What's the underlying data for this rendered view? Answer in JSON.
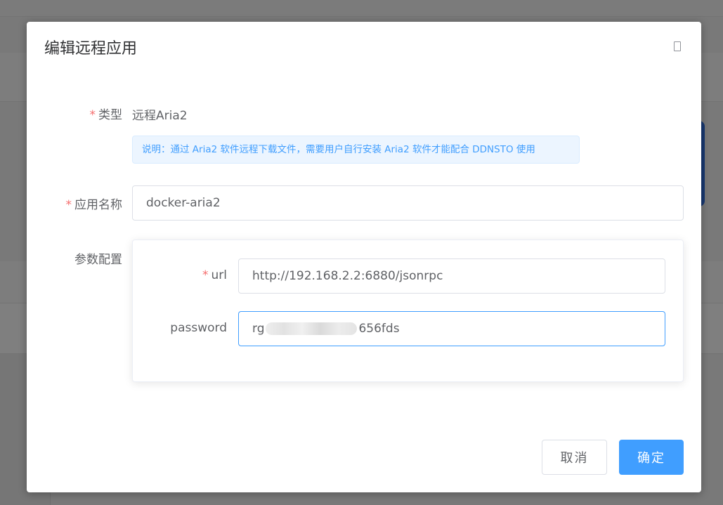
{
  "dialog": {
    "title": "编辑远程应用",
    "close_icon": "close-icon"
  },
  "form": {
    "required_mark": "*",
    "type": {
      "label": "类型",
      "value": "远程Aria2"
    },
    "notice": "说明：通过 Aria2 软件远程下载文件，需要用户自行安装 Aria2 软件才能配合 DDNSTO 使用",
    "app_name": {
      "label": "应用名称",
      "value": "docker-aria2"
    },
    "params": {
      "label": "参数配置",
      "url": {
        "label": "url",
        "value": "http://192.168.2.2:6880/jsonrpc"
      },
      "password": {
        "label": "password",
        "value_prefix": "rg",
        "value_suffix": "656fds"
      }
    }
  },
  "footer": {
    "cancel_label": "取消",
    "confirm_label": "确定"
  },
  "colors": {
    "primary": "#409eff",
    "required": "#f56c6c",
    "text": "#606266"
  }
}
